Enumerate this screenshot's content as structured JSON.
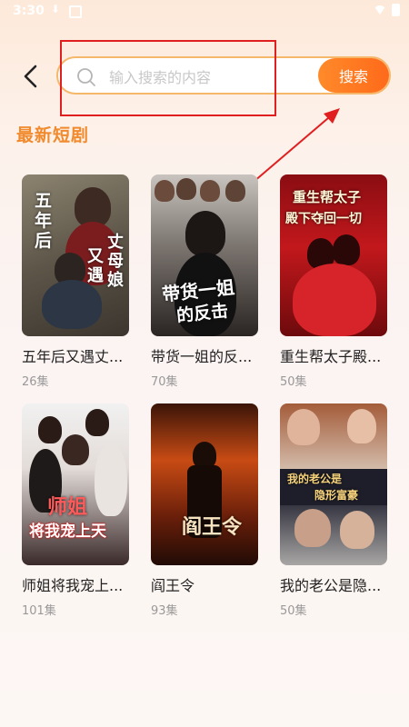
{
  "status_bar": {
    "time": "3:30"
  },
  "search": {
    "placeholder": "输入搜索的内容",
    "value": "",
    "button_label": "搜索"
  },
  "section_title": "最新短剧",
  "dramas": [
    {
      "title": "五年后又遇丈...",
      "episodes": "26集",
      "poster_text": [
        "五年后",
        "又遇",
        "丈母娘"
      ]
    },
    {
      "title": "带货一姐的反...",
      "episodes": "70集",
      "poster_text": [
        "带货一姐",
        "的反击"
      ]
    },
    {
      "title": "重生帮太子殿...",
      "episodes": "50集",
      "poster_text": [
        "重生帮太子",
        "殿下夺回一切"
      ]
    },
    {
      "title": "师姐将我宠上...",
      "episodes": "101集",
      "poster_text": [
        "师姐",
        "将我宠上天"
      ]
    },
    {
      "title": "阎王令",
      "episodes": "93集",
      "poster_text": [
        "阎王令"
      ]
    },
    {
      "title": "我的老公是隐...",
      "episodes": "50集",
      "poster_text": [
        "我的老公是",
        "隐形富豪"
      ]
    }
  ],
  "colors": {
    "accent": "#ff7a22",
    "section_title": "#f08a2c",
    "annotation": "#e02020"
  }
}
